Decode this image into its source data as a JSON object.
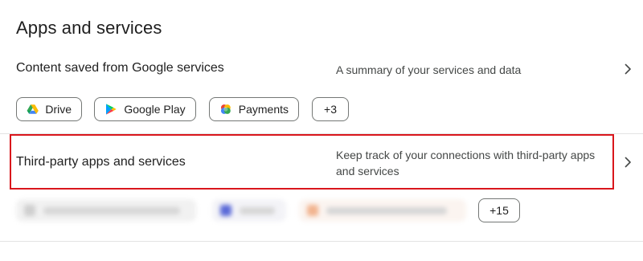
{
  "section": {
    "title": "Apps and services"
  },
  "google_services": {
    "title": "Content saved from Google services",
    "description": "A summary of your services and data",
    "chips": [
      {
        "label": "Drive",
        "icon": "google-drive-icon"
      },
      {
        "label": "Google Play",
        "icon": "google-play-icon"
      },
      {
        "label": "Payments",
        "icon": "google-pay-icon"
      }
    ],
    "more_label": "+3"
  },
  "third_party": {
    "title": "Third-party apps and services",
    "description": "Keep track of your connections with third-party apps and services",
    "more_label": "+15",
    "highlight_color": "#d9161c"
  },
  "icons": {
    "chevron": "chevron-right-icon"
  }
}
